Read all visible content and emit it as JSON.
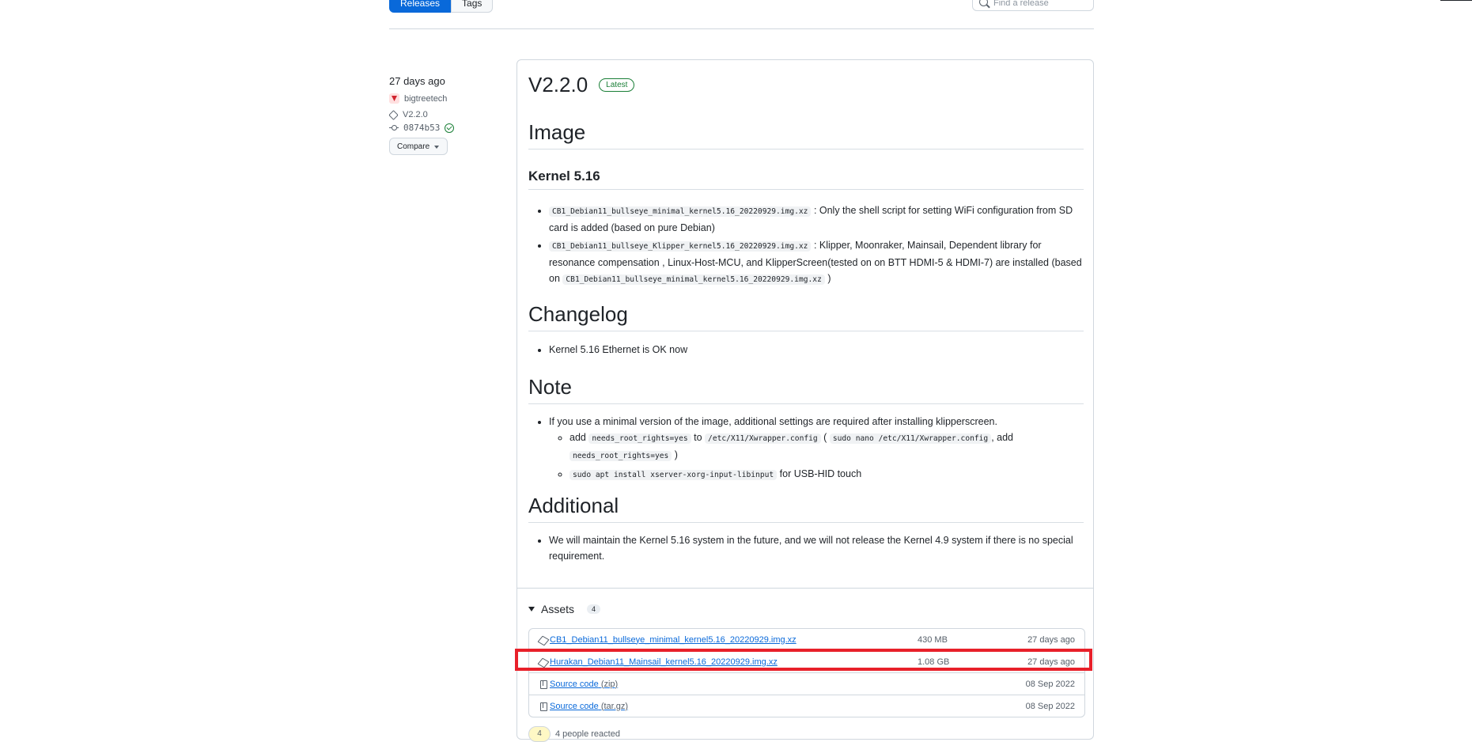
{
  "tabs": {
    "releases": "Releases",
    "tags": "Tags"
  },
  "search": {
    "placeholder": "Find a release"
  },
  "release": {
    "date": "27 days ago",
    "author": "bigtreetech",
    "tag": "V2.2.0",
    "commit": "0874b53",
    "compare_label": "Compare",
    "title": "V2.2.0",
    "latest_badge": "Latest"
  },
  "notes": {
    "h_image": "Image",
    "h_kernel": "Kernel 5.16",
    "image_items": [
      {
        "code": "CB1_Debian11_bullseye_minimal_kernel5.16_20220929.img.xz",
        "text": ": Only the shell script for setting WiFi configuration from SD card is added (based on pure Debian)"
      },
      {
        "code": "CB1_Debian11_bullseye_Klipper_kernel5.16_20220929.img.xz",
        "text": ": Klipper, Moonraker, Mainsail, Dependent library for resonance compensation , Linux-Host-MCU, and KlipperScreen(tested on on BTT HDMI-5 & HDMI-7) are installed (based on",
        "code2": "CB1_Debian11_bullseye_minimal_kernel5.16_20220929.img.xz",
        "tail": ")"
      }
    ],
    "h_changelog": "Changelog",
    "changelog_item": "Kernel 5.16 Ethernet is OK now",
    "h_note": "Note",
    "note_item": "If you use a minimal version of the image, additional settings are required after installing klipperscreen.",
    "note_sub1": {
      "a": "add",
      "c1": "needs_root_rights=yes",
      "b": "to",
      "c2": "/etc/X11/Xwrapper.config",
      "d": "(",
      "c3": "sudo nano /etc/X11/Xwrapper.config",
      "e": ", add",
      "c4": "needs_root_rights=yes",
      "f": ")"
    },
    "note_sub2": {
      "c1": "sudo apt install xserver-xorg-input-libinput",
      "a": "for USB-HID touch"
    },
    "h_additional": "Additional",
    "additional_item": "We will maintain the Kernel 5.16 system in the future, and we will not release the Kernel 4.9 system if there is no special requirement."
  },
  "assets": {
    "label": "Assets",
    "count": "4",
    "items": [
      {
        "name": "CB1_Debian11_bullseye_minimal_kernel5.16_20220929.img.xz",
        "size": "430 MB",
        "date": "27 days ago"
      },
      {
        "name": "Hurakan_Debian11_Mainsail_kernel5.16_20220929.img.xz",
        "size": "1.08 GB",
        "date": "27 days ago"
      },
      {
        "name": "Source code",
        "fmt": "(zip)",
        "date": "08 Sep 2022"
      },
      {
        "name": "Source code",
        "fmt": "(tar.gz)",
        "date": "08 Sep 2022"
      }
    ]
  },
  "reactions": {
    "count": "4",
    "text": "4 people reacted"
  }
}
